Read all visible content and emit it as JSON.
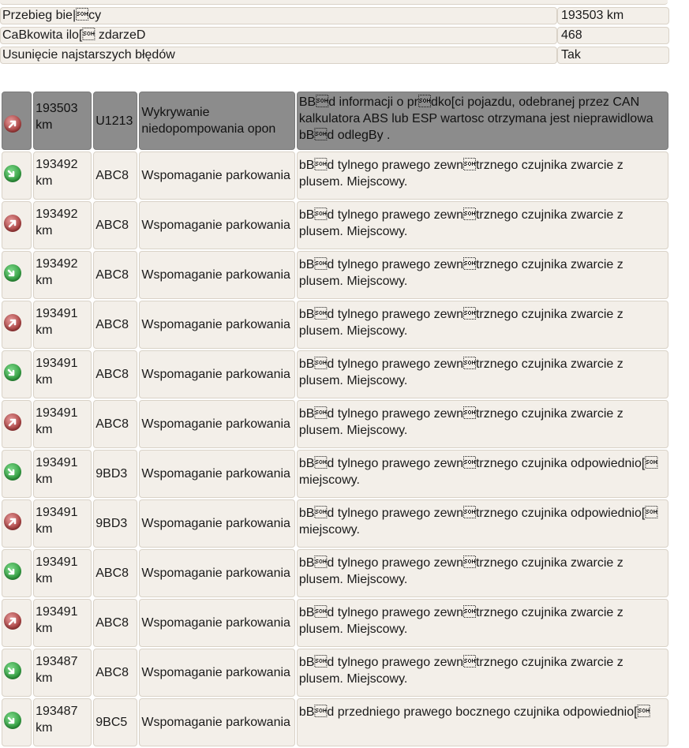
{
  "summary": [
    {
      "label": "Przebieg bie|\u0001cy",
      "value": "193503 km"
    },
    {
      "label": "CaBkowita ilo[\u0001 zdarzeD",
      "value": "468"
    },
    {
      "label": "Usunięcie najstarszych błędów",
      "value": "Tak"
    }
  ],
  "events": [
    {
      "status": "bad",
      "km_num": "193503",
      "km_unit": "km",
      "code": "U1213",
      "system": "Wykrywanie niedopompowania opon",
      "desc": "BB\u0001d informacji o pr\u0001dko[ci pojazdu, odebranej przez CAN kalkulatora ABS lub ESP wartosc otrzymana jest nieprawidlowa bB\u0001d odlegBy ."
    },
    {
      "status": "good",
      "km_num": "193492",
      "km_unit": "km",
      "code": "ABC8",
      "system": "Wspomaganie parkowania",
      "desc": "bB\u0001d tylnego prawego zewn\u0001trznego czujnika zwarcie z plusem. Miejscowy."
    },
    {
      "status": "bad",
      "km_num": "193492",
      "km_unit": "km",
      "code": "ABC8",
      "system": "Wspomaganie parkowania",
      "desc": "bB\u0001d tylnego prawego zewn\u0001trznego czujnika zwarcie z plusem. Miejscowy."
    },
    {
      "status": "good",
      "km_num": "193492",
      "km_unit": "km",
      "code": "ABC8",
      "system": "Wspomaganie parkowania",
      "desc": "bB\u0001d tylnego prawego zewn\u0001trznego czujnika zwarcie z plusem. Miejscowy."
    },
    {
      "status": "bad",
      "km_num": "193491",
      "km_unit": "km",
      "code": "ABC8",
      "system": "Wspomaganie parkowania",
      "desc": "bB\u0001d tylnego prawego zewn\u0001trznego czujnika zwarcie z plusem. Miejscowy."
    },
    {
      "status": "good",
      "km_num": "193491",
      "km_unit": "km",
      "code": "ABC8",
      "system": "Wspomaganie parkowania",
      "desc": "bB\u0001d tylnego prawego zewn\u0001trznego czujnika zwarcie z plusem. Miejscowy."
    },
    {
      "status": "bad",
      "km_num": "193491",
      "km_unit": "km",
      "code": "ABC8",
      "system": "Wspomaganie parkowania",
      "desc": "bB\u0001d tylnego prawego zewn\u0001trznego czujnika zwarcie z plusem. Miejscowy."
    },
    {
      "status": "good",
      "km_num": "193491",
      "km_unit": "km",
      "code": "9BD3",
      "system": "Wspomaganie parkowania",
      "desc": "bB\u0001d tylnego prawego zewn\u0001trznego czujnika odpowiednio[\u0001 miejscowy."
    },
    {
      "status": "bad",
      "km_num": "193491",
      "km_unit": "km",
      "code": "9BD3",
      "system": "Wspomaganie parkowania",
      "desc": "bB\u0001d tylnego prawego zewn\u0001trznego czujnika odpowiednio[\u0001 miejscowy."
    },
    {
      "status": "good",
      "km_num": "193491",
      "km_unit": "km",
      "code": "ABC8",
      "system": "Wspomaganie parkowania",
      "desc": "bB\u0001d tylnego prawego zewn\u0001trznego czujnika zwarcie z plusem. Miejscowy."
    },
    {
      "status": "bad",
      "km_num": "193491",
      "km_unit": "km",
      "code": "ABC8",
      "system": "Wspomaganie parkowania",
      "desc": "bB\u0001d tylnego prawego zewn\u0001trznego czujnika zwarcie z plusem. Miejscowy."
    },
    {
      "status": "good",
      "km_num": "193487",
      "km_unit": "km",
      "code": "ABC8",
      "system": "Wspomaganie parkowania",
      "desc": "bB\u0001d tylnego prawego zewn\u0001trznego czujnika zwarcie z plusem. Miejscowy."
    },
    {
      "status": "good",
      "km_num": "193487",
      "km_unit": "km",
      "code": "9BC5",
      "system": "Wspomaganie parkowania",
      "desc": "bB\u0001d przedniego prawego bocznego czujnika odpowiednio[\u0001"
    }
  ],
  "icons": {
    "good": "arrow-down-right-icon",
    "bad": "arrow-up-right-icon"
  },
  "colors": {
    "cell_bg": "#f3efe9",
    "current_row_bg": "#8c8c8c",
    "good": "#2e9a3d",
    "bad": "#a63c3c"
  }
}
